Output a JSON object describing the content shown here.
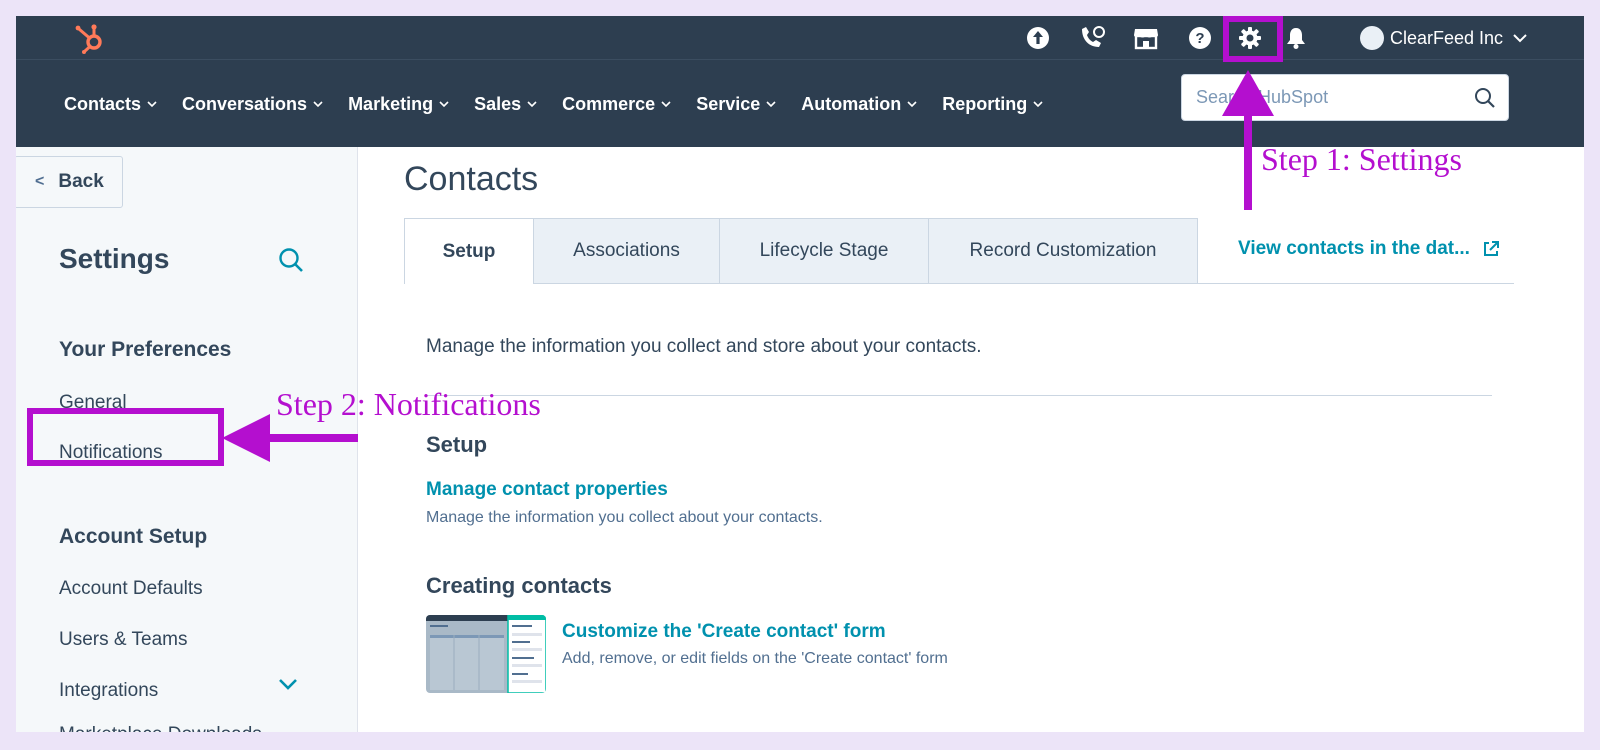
{
  "account": {
    "name": "ClearFeed Inc"
  },
  "nav": {
    "items": [
      {
        "label": "Contacts"
      },
      {
        "label": "Conversations"
      },
      {
        "label": "Marketing"
      },
      {
        "label": "Sales"
      },
      {
        "label": "Commerce"
      },
      {
        "label": "Service"
      },
      {
        "label": "Automation"
      },
      {
        "label": "Reporting"
      }
    ],
    "search_placeholder": "Search HubSpot"
  },
  "sidebar": {
    "back_label": "Back",
    "title": "Settings",
    "sections": [
      {
        "heading": "Your Preferences",
        "items": [
          "General",
          "Notifications"
        ]
      },
      {
        "heading": "Account Setup",
        "items": [
          "Account Defaults",
          "Users & Teams",
          "Integrations",
          "Marketplace Downloads"
        ]
      }
    ]
  },
  "main": {
    "title": "Contacts",
    "tabs": [
      "Setup",
      "Associations",
      "Lifecycle Stage",
      "Record Customization"
    ],
    "view_link": "View contacts in the dat...",
    "intro": "Manage the information you collect and store about your contacts.",
    "setup": {
      "heading": "Setup",
      "link": "Manage contact properties",
      "desc": "Manage the information you collect about your contacts."
    },
    "creating": {
      "heading": "Creating contacts",
      "link": "Customize the 'Create contact' form",
      "desc": "Add, remove, or edit fields on the 'Create contact' form"
    }
  },
  "annotations": {
    "step1": "Step 1: Settings",
    "step2": "Step 2: Notifications",
    "color": "#b40fcf"
  },
  "colors": {
    "nav_bg": "#2d3e50",
    "link": "#0091ae",
    "brand": "#ff7a59",
    "page_bg": "#ece4f8"
  }
}
